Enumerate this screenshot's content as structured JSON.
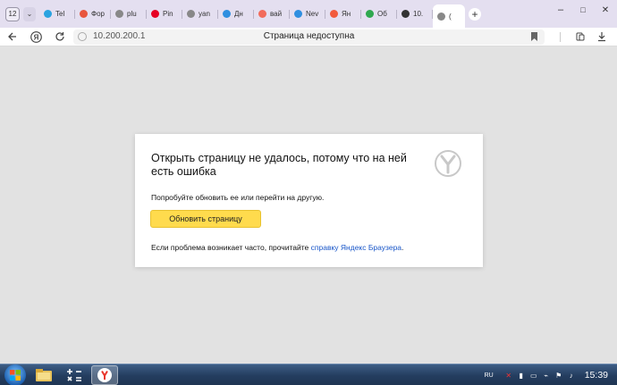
{
  "tabbar": {
    "tab_count": "12",
    "tabs": [
      {
        "label": "Tel",
        "color": "#2aa3e0"
      },
      {
        "label": "Фор",
        "color": "#e8553d"
      },
      {
        "label": "plu",
        "color": "#888888"
      },
      {
        "label": "Pin",
        "color": "#e60023"
      },
      {
        "label": "yan",
        "color": "#888888"
      },
      {
        "label": "Дн",
        "color": "#2f8fe0"
      },
      {
        "label": "вай",
        "color": "#f26b5b"
      },
      {
        "label": "Nev",
        "color": "#2f8fe0"
      },
      {
        "label": "Ян",
        "color": "#f25b3d"
      },
      {
        "label": "Об",
        "color": "#2fa84f"
      },
      {
        "label": "10.",
        "color": "#333333"
      },
      {
        "label": "(",
        "color": "#888888"
      }
    ],
    "new_tab": "+",
    "minimize": "–",
    "restore": "□",
    "close": "✕"
  },
  "addressbar": {
    "url": "10.200.200.1",
    "page_title": "Страница недоступна"
  },
  "error_card": {
    "title": "Открыть страницу не удалось, потому что на ней есть ошибка",
    "hint": "Попробуйте обновить ее или перейти на другую.",
    "reload_label": "Обновить страницу",
    "footer_prefix": "Если проблема возникает часто, прочитайте ",
    "footer_link": "справку Яндекс Браузера",
    "footer_suffix": "."
  },
  "taskbar": {
    "language": "RU",
    "clock": "15:39"
  },
  "colors": {
    "accent_button": "#ffdb4d",
    "link": "#1a57c9"
  }
}
